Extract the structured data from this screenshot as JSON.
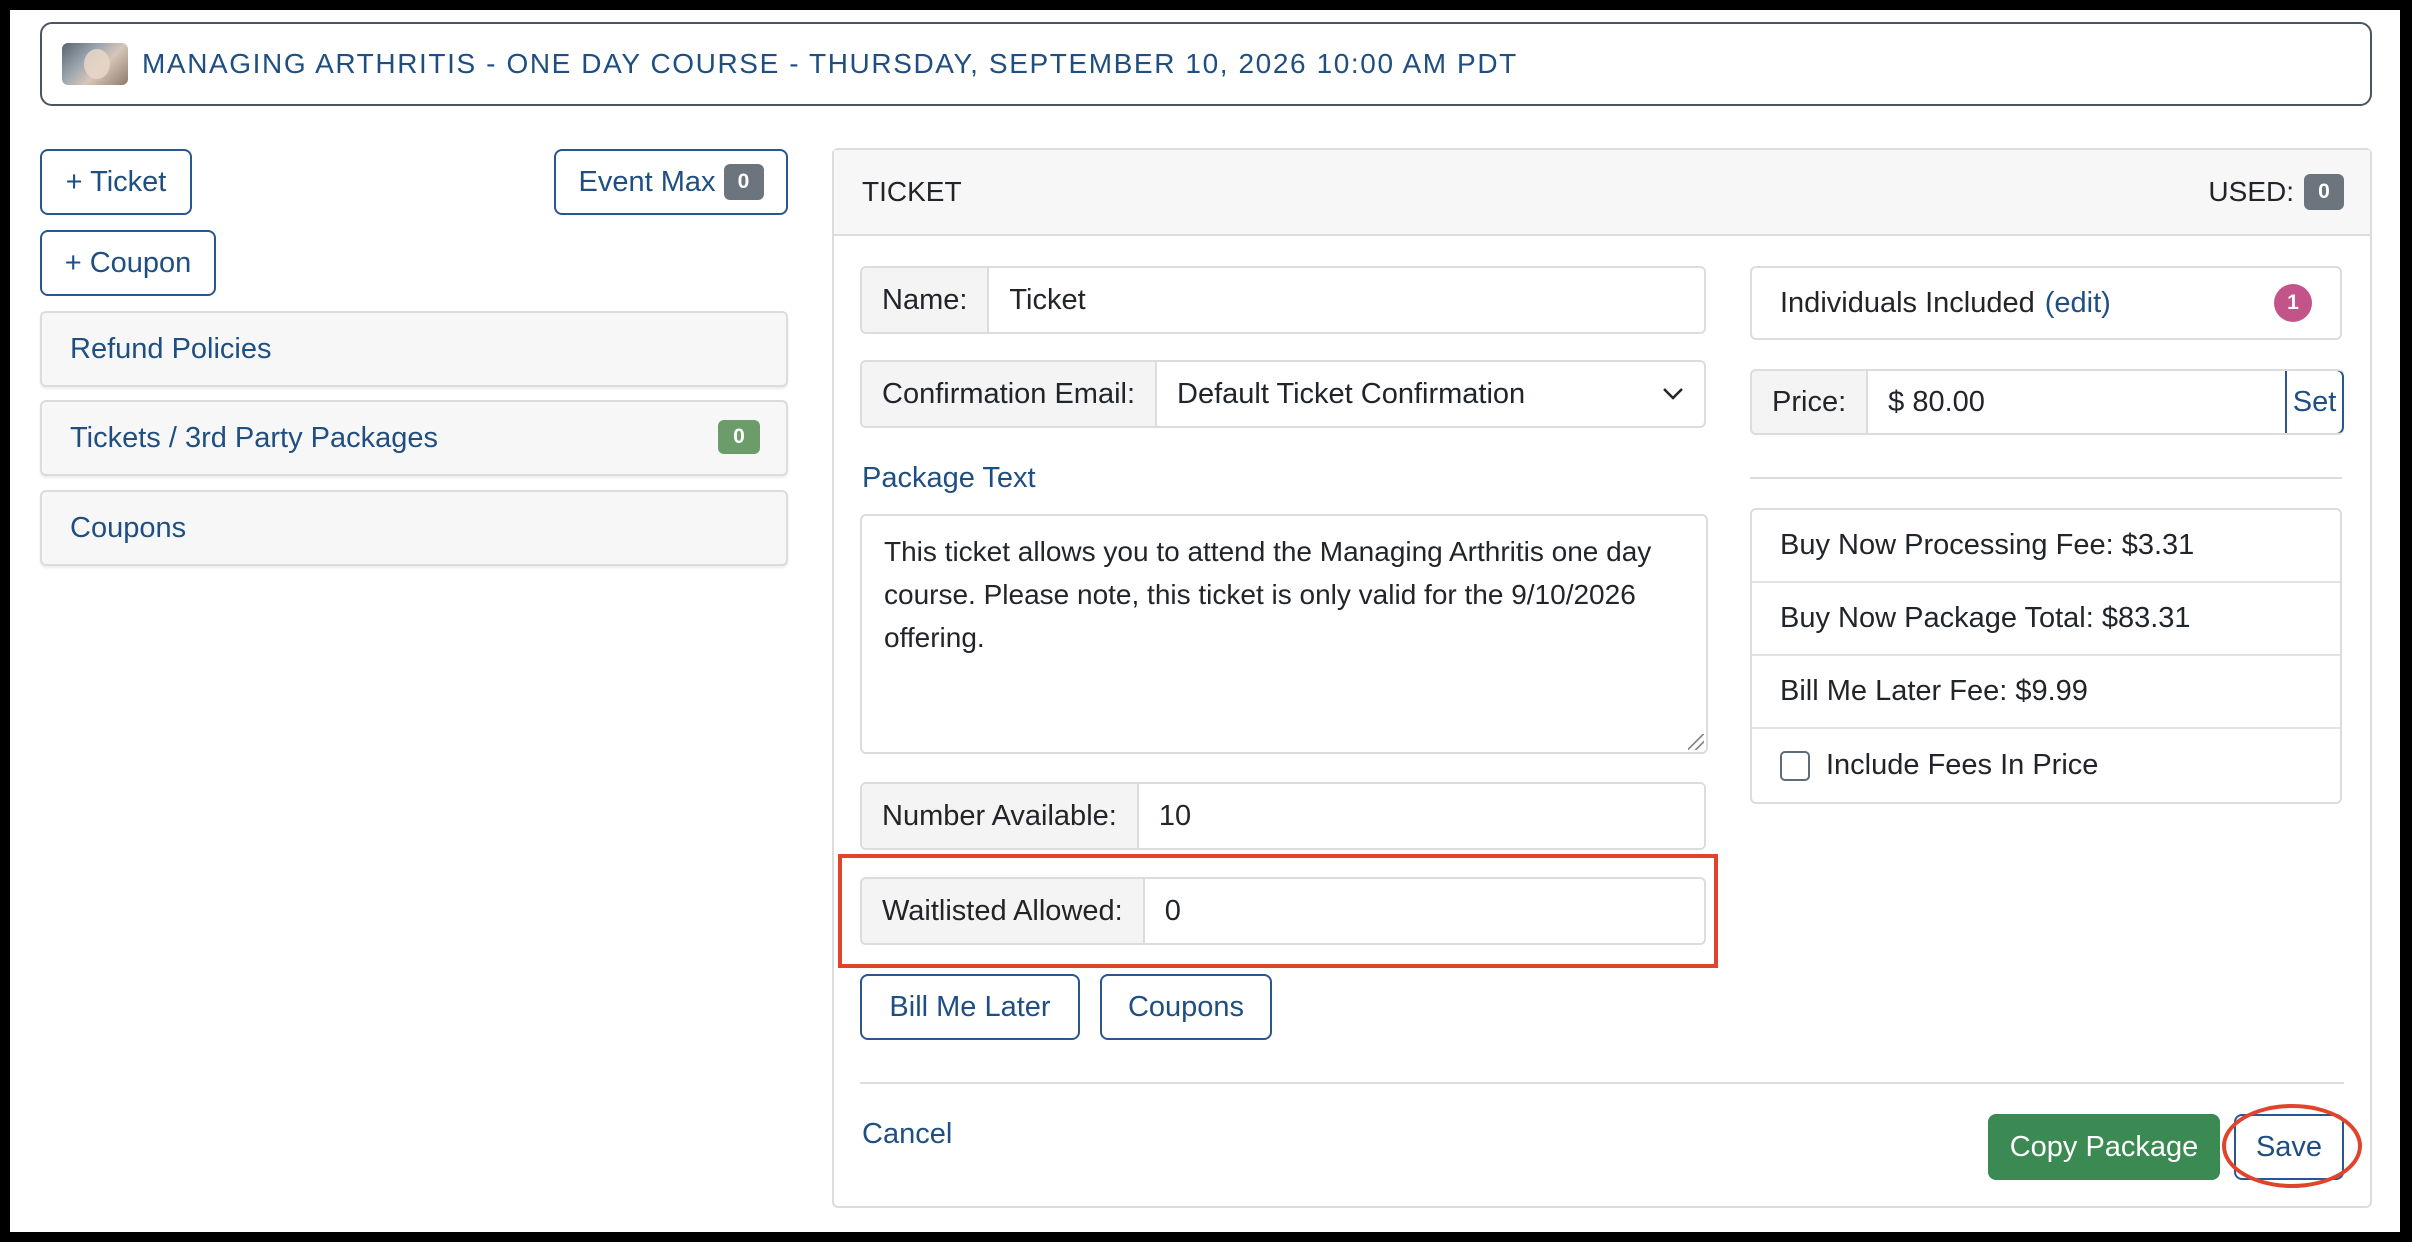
{
  "header": {
    "title": "MANAGING ARTHRITIS - ONE DAY COURSE - THURSDAY, SEPTEMBER 10, 2026 10:00 AM PDT"
  },
  "left": {
    "add_ticket_label": "+ Ticket",
    "add_coupon_label": "+ Coupon",
    "event_max_label": "Event Max",
    "event_max_count": "0",
    "accordion": [
      {
        "label": "Refund Policies"
      },
      {
        "label": "Tickets / 3rd Party Packages",
        "badge": "0"
      },
      {
        "label": "Coupons"
      }
    ]
  },
  "card": {
    "title": "TICKET",
    "used_label": "USED:",
    "used_count": "0",
    "name_label": "Name:",
    "name_value": "Ticket",
    "confirmation_label": "Confirmation Email:",
    "confirmation_value": "Default Ticket Confirmation",
    "package_text_label": "Package Text",
    "package_text": "This ticket allows you to attend the Managing Arthritis one day course. Please note, this ticket is only valid for the 9/10/2026 offering.",
    "number_available_label": "Number Available:",
    "number_available_value": "10",
    "waitlisted_label": "Waitlisted Allowed:",
    "waitlisted_value": "0",
    "bill_me_later_label": "Bill Me Later",
    "coupons_label": "Coupons",
    "cancel_label": "Cancel",
    "copy_package_label": "Copy Package",
    "save_label": "Save",
    "individuals_label": "Individuals Included",
    "individuals_edit": "(edit)",
    "individuals_count": "1",
    "price_label": "Price:",
    "price_value": "$ 80.00",
    "set_label": "Set",
    "fees": [
      "Buy Now Processing Fee: $3.31",
      "Buy Now Package Total: $83.31",
      "Bill Me Later Fee: $9.99"
    ],
    "include_fees_label": "Include Fees In Price",
    "include_fees_checked": false
  },
  "colors": {
    "accent": "#1f4f82",
    "success": "#3c8a53",
    "highlight": "#e0442b"
  }
}
